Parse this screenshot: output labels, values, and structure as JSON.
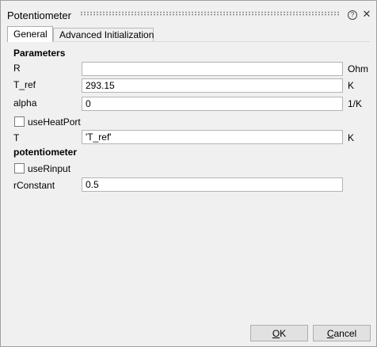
{
  "window": {
    "title": "Potentiometer",
    "help_icon": "help-icon",
    "close_icon": "close-icon"
  },
  "tabs": [
    {
      "label": "General",
      "active": true
    },
    {
      "label": "Advanced Initialization",
      "active": false
    }
  ],
  "sections": {
    "parameters": "Parameters",
    "potentiometer": "potentiometer"
  },
  "params": [
    {
      "label": "R",
      "value": "",
      "unit": "Ohm"
    },
    {
      "label": "T_ref",
      "value": "293.15",
      "unit": "K"
    },
    {
      "label": "alpha",
      "value": "0",
      "unit": "1/K"
    }
  ],
  "use_heat_port": {
    "label": "useHeatPort",
    "checked": false
  },
  "t_param": {
    "label": "T",
    "value": "'T_ref'",
    "unit": "K"
  },
  "use_r_input": {
    "label": "useRinput",
    "checked": false
  },
  "r_constant": {
    "label": "rConstant",
    "value": "0.5"
  },
  "buttons": {
    "ok": "OK",
    "cancel": "Cancel"
  }
}
